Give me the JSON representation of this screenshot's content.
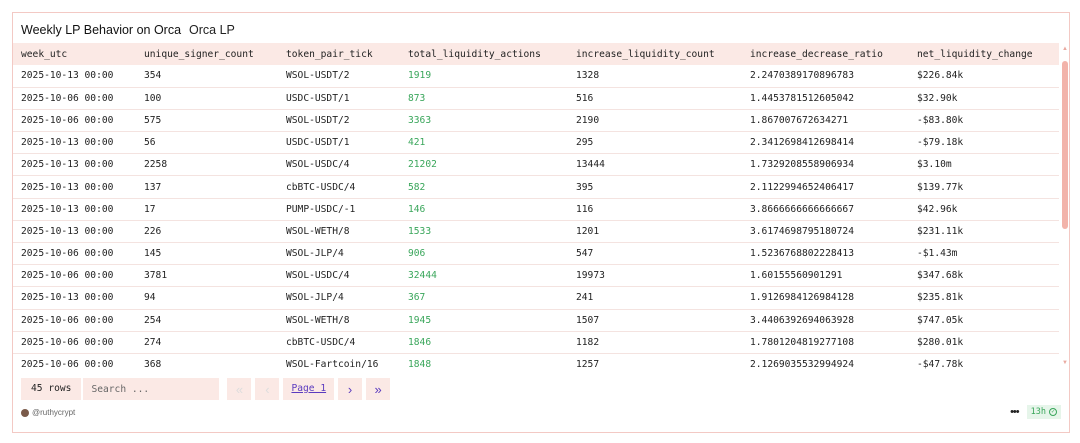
{
  "header": {
    "title": "Weekly LP Behavior on Orca",
    "subtitle": "Orca LP"
  },
  "table": {
    "columns": [
      "week_utc",
      "unique_signer_count",
      "token_pair_tick",
      "total_liquidity_actions",
      "increase_liquidity_count",
      "increase_decrease_ratio",
      "net_liquidity_change"
    ],
    "rows": [
      [
        "2025-10-13 00:00",
        "354",
        "WSOL-USDT/2",
        "1919",
        "1328",
        "2.2470389170896783",
        "$226.84k"
      ],
      [
        "2025-10-06 00:00",
        "100",
        "USDC-USDT/1",
        "873",
        "516",
        "1.4453781512605042",
        "$32.90k"
      ],
      [
        "2025-10-06 00:00",
        "575",
        "WSOL-USDT/2",
        "3363",
        "2190",
        "1.867007672634271",
        "-$83.80k"
      ],
      [
        "2025-10-13 00:00",
        "56",
        "USDC-USDT/1",
        "421",
        "295",
        "2.3412698412698414",
        "-$79.18k"
      ],
      [
        "2025-10-13 00:00",
        "2258",
        "WSOL-USDC/4",
        "21202",
        "13444",
        "1.7329208558906934",
        "$3.10m"
      ],
      [
        "2025-10-13 00:00",
        "137",
        "cbBTC-USDC/4",
        "582",
        "395",
        "2.1122994652406417",
        "$139.77k"
      ],
      [
        "2025-10-13 00:00",
        "17",
        "PUMP-USDC/-1",
        "146",
        "116",
        "3.8666666666666667",
        "$42.96k"
      ],
      [
        "2025-10-13 00:00",
        "226",
        "WSOL-WETH/8",
        "1533",
        "1201",
        "3.6174698795180724",
        "$231.11k"
      ],
      [
        "2025-10-06 00:00",
        "145",
        "WSOL-JLP/4",
        "906",
        "547",
        "1.5236768802228413",
        "-$1.43m"
      ],
      [
        "2025-10-06 00:00",
        "3781",
        "WSOL-USDC/4",
        "32444",
        "19973",
        "1.60155560901291",
        "$347.68k"
      ],
      [
        "2025-10-13 00:00",
        "94",
        "WSOL-JLP/4",
        "367",
        "241",
        "1.9126984126984128",
        "$235.81k"
      ],
      [
        "2025-10-06 00:00",
        "254",
        "WSOL-WETH/8",
        "1945",
        "1507",
        "3.4406392694063928",
        "$747.05k"
      ],
      [
        "2025-10-06 00:00",
        "274",
        "cbBTC-USDC/4",
        "1846",
        "1182",
        "1.7801204819277108",
        "$280.01k"
      ],
      [
        "2025-10-06 00:00",
        "368",
        "WSOL-Fartcoin/16",
        "1848",
        "1257",
        "2.1269035532994924",
        "-$47.78k"
      ]
    ]
  },
  "footer": {
    "rows_label": "45 rows",
    "search_placeholder": "Search ...",
    "page_label": "Page 1",
    "first_icon": "double-chevron-left-icon",
    "prev_icon": "chevron-left-icon",
    "next_icon": "chevron-right-icon",
    "last_icon": "double-chevron-right-icon"
  },
  "author": "@ruthycrypt",
  "age_badge": "13h",
  "colors": {
    "accent": "#f2b3aa",
    "header_bg": "#fbe9e5",
    "positive": "#3aa65b",
    "link": "#5b3bbf"
  }
}
